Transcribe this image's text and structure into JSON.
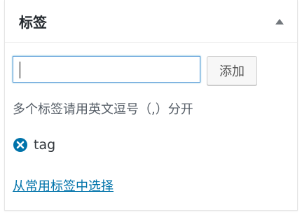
{
  "panel": {
    "title": "标签",
    "toggle_icon": "triangle-up-icon"
  },
  "input": {
    "value": "",
    "placeholder": ""
  },
  "add_button": {
    "label": "添加"
  },
  "hint": "多个标签请用英文逗号（,）分开",
  "tags": [
    {
      "label": "tag",
      "remove_icon": "remove-circle-x-icon"
    }
  ],
  "popular_link": "从常用标签中选择",
  "colors": {
    "link": "#0073aa",
    "remove_icon": "#0073aa",
    "input_focus_border": "#5b9dd9",
    "title": "#23282d"
  }
}
